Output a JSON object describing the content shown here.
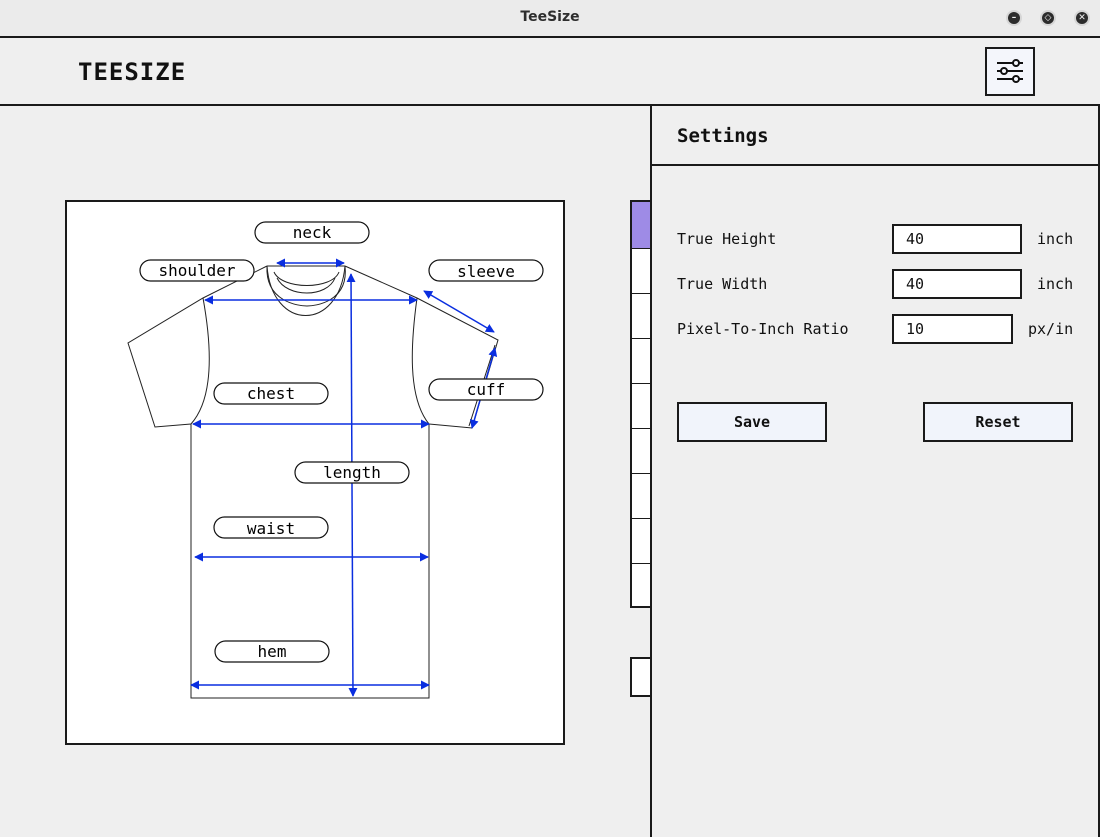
{
  "window": {
    "title": "TeeSize"
  },
  "header": {
    "brand": "TEESIZE",
    "settings_button_icon": "sliders-icon"
  },
  "diagram": {
    "labels": {
      "neck": "neck",
      "shoulder": "shoulder",
      "sleeve": "sleeve",
      "chest": "chest",
      "cuff": "cuff",
      "length": "length",
      "waist": "waist",
      "hem": "hem"
    },
    "arrow_color": "#0a2ee0",
    "outline_color": "#222222"
  },
  "side_list": {
    "active_color": "#9e8be6"
  },
  "settings": {
    "title": "Settings",
    "fields": {
      "true_height": {
        "label": "True Height",
        "value": "40",
        "unit": "inch"
      },
      "true_width": {
        "label": "True Width",
        "value": "40",
        "unit": "inch"
      },
      "ratio": {
        "label": "Pixel-To-Inch Ratio",
        "value": "10",
        "unit": "px/in"
      }
    },
    "save_label": "Save",
    "reset_label": "Reset"
  }
}
